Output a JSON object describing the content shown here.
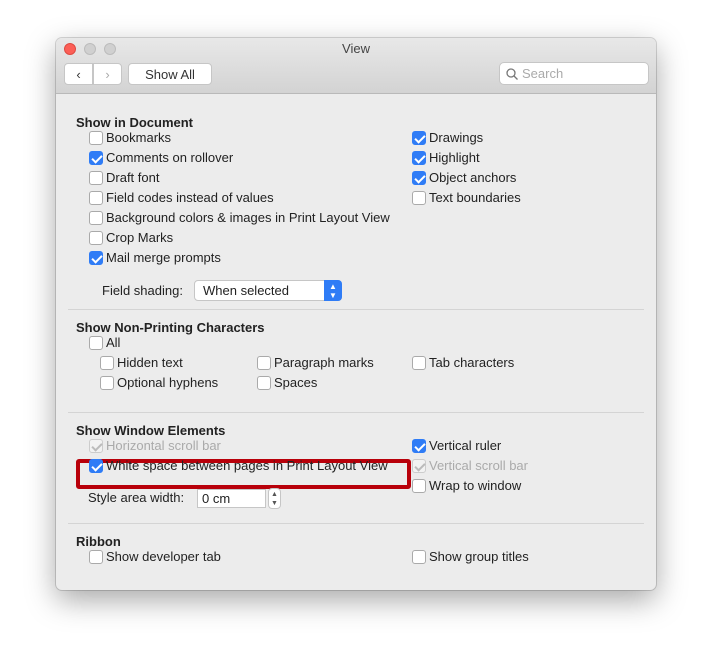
{
  "window": {
    "title": "View",
    "show_all": "Show All",
    "search_placeholder": "Search"
  },
  "sections": {
    "document": {
      "title": "Show in Document",
      "field_shading_label": "Field shading:",
      "field_shading_value": "When selected"
    },
    "nonprinting": {
      "title": "Show Non-Printing Characters"
    },
    "window_elements": {
      "title": "Show Window Elements",
      "style_area_label": "Style area width:",
      "style_area_value": "0 cm"
    },
    "ribbon": {
      "title": "Ribbon"
    }
  },
  "checkboxes": [
    {
      "label": "Bookmarks",
      "checked": false
    },
    {
      "label": "Comments on rollover",
      "checked": true
    },
    {
      "label": "Draft font",
      "checked": false
    },
    {
      "label": "Field codes instead of values",
      "checked": false
    },
    {
      "label": "Background colors & images in Print Layout View",
      "checked": false
    },
    {
      "label": "Crop Marks",
      "checked": false
    },
    {
      "label": "Mail merge prompts",
      "checked": true
    },
    {
      "label": "Drawings",
      "checked": true
    },
    {
      "label": "Highlight",
      "checked": true
    },
    {
      "label": "Object anchors",
      "checked": true
    },
    {
      "label": "Text boundaries",
      "checked": false
    },
    {
      "label": "All",
      "checked": false
    },
    {
      "label": "Hidden text",
      "checked": false
    },
    {
      "label": "Paragraph marks",
      "checked": false
    },
    {
      "label": "Tab characters",
      "checked": false
    },
    {
      "label": "Optional hyphens",
      "checked": false
    },
    {
      "label": "Spaces",
      "checked": false
    },
    {
      "label": "Horizontal scroll bar",
      "checked": true,
      "disabled": true
    },
    {
      "label": "White space between pages in Print Layout View",
      "checked": true,
      "highlighted": true
    },
    {
      "label": "Vertical ruler",
      "checked": true
    },
    {
      "label": "Vertical scroll bar",
      "checked": true,
      "disabled": true
    },
    {
      "label": "Wrap to window",
      "checked": false
    },
    {
      "label": "Show developer tab",
      "checked": false
    },
    {
      "label": "Show group titles",
      "checked": false
    }
  ],
  "colors": {
    "accent": "#2f7cf6",
    "highlight_box": "#b8000a"
  }
}
